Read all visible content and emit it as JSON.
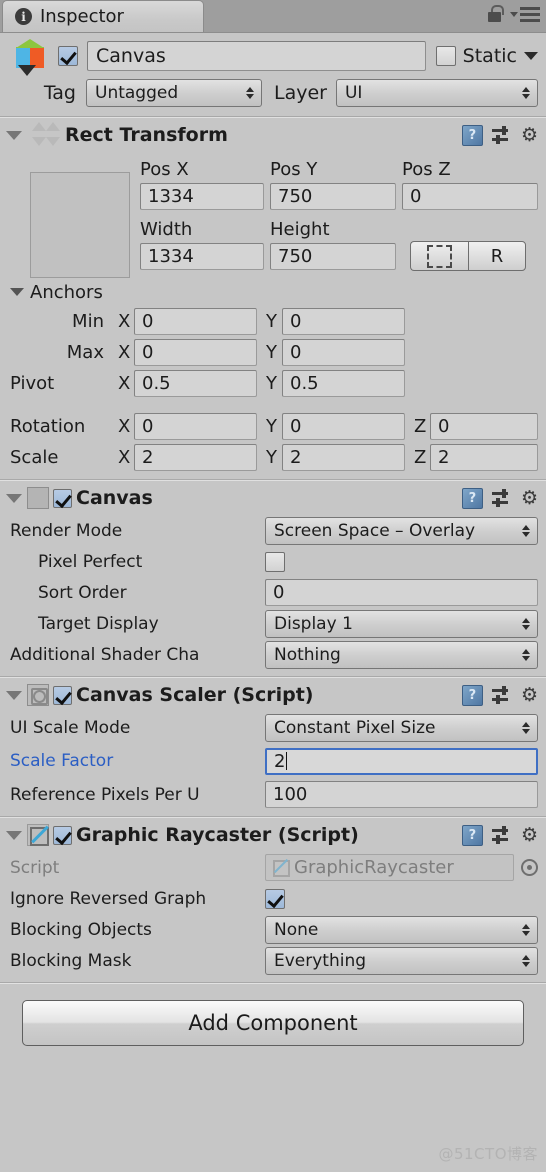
{
  "window": {
    "tab_label": "Inspector",
    "info_icon": "info-icon",
    "lock_icon": "lock-icon",
    "menu_icon": "hamburger-menu-icon"
  },
  "gameobject": {
    "icon": "unity-cube-icon",
    "enabled": true,
    "name": "Canvas",
    "static_label": "Static",
    "static_checked": false,
    "tag_label": "Tag",
    "tag_value": "Untagged",
    "layer_label": "Layer",
    "layer_value": "UI"
  },
  "components": [
    {
      "title": "Rect Transform",
      "icon": "rect-transform-icon",
      "expanded": true,
      "pos_labels": [
        "Pos X",
        "Pos Y",
        "Pos Z"
      ],
      "pos_values": [
        "1334",
        "750",
        "0"
      ],
      "size_labels": [
        "Width",
        "Height"
      ],
      "size_values": [
        "1334",
        "750"
      ],
      "blueprint_button": "blueprint-mode",
      "raw_button": "R",
      "anchors_label": "Anchors",
      "anchor_rows": [
        {
          "label": "Min",
          "x_axis": "X",
          "x": "0",
          "y_axis": "Y",
          "y": "0"
        },
        {
          "label": "Max",
          "x_axis": "X",
          "x": "0",
          "y_axis": "Y",
          "y": "0"
        },
        {
          "label": "Pivot",
          "x_axis": "X",
          "x": "0.5",
          "y_axis": "Y",
          "y": "0.5"
        }
      ],
      "xform_rows": [
        {
          "label": "Rotation",
          "x_axis": "X",
          "x": "0",
          "y_axis": "Y",
          "y": "0",
          "z_axis": "Z",
          "z": "0"
        },
        {
          "label": "Scale",
          "x_axis": "X",
          "x": "2",
          "y_axis": "Y",
          "y": "2",
          "z_axis": "Z",
          "z": "2"
        }
      ]
    },
    {
      "title": "Canvas",
      "icon": "canvas-icon",
      "enabled": true,
      "rows": [
        {
          "label": "Render Mode",
          "type": "popup",
          "value": "Screen Space – Overlay"
        },
        {
          "label": "Pixel Perfect",
          "type": "checkbox",
          "checked": false
        },
        {
          "label": "Sort Order",
          "type": "text",
          "value": "0"
        },
        {
          "label": "Target Display",
          "type": "popup",
          "value": "Display 1"
        },
        {
          "label": "Additional Shader Cha",
          "type": "popup",
          "value": "Nothing"
        }
      ]
    },
    {
      "title": "Canvas Scaler (Script)",
      "icon": "canvas-scaler-icon",
      "enabled": true,
      "rows": [
        {
          "label": "UI Scale Mode",
          "type": "popup",
          "value": "Constant Pixel Size"
        },
        {
          "label": "Scale Factor",
          "type": "text",
          "value": "2",
          "focused": true,
          "highlighted": true
        },
        {
          "label": "Reference Pixels Per U",
          "type": "text",
          "value": "100"
        }
      ]
    },
    {
      "title": "Graphic Raycaster (Script)",
      "icon": "graphic-raycaster-icon",
      "enabled": true,
      "rows": [
        {
          "label": "Script",
          "type": "object",
          "value": "GraphicRaycaster",
          "disabled": true
        },
        {
          "label": "Ignore Reversed Graph",
          "type": "checkbox",
          "checked": true
        },
        {
          "label": "Blocking Objects",
          "type": "popup",
          "value": "None"
        },
        {
          "label": "Blocking Mask",
          "type": "popup",
          "value": "Everything"
        }
      ]
    }
  ],
  "footer": {
    "add_component_label": "Add Component",
    "watermark": "@51CTO博客"
  },
  "colors": {
    "background": "#c6c6c6",
    "field": "#d4d4d4",
    "focus_border": "#3f6fc4",
    "highlight_label": "#2b5ec4",
    "tabbar": "#9e9e9e"
  }
}
